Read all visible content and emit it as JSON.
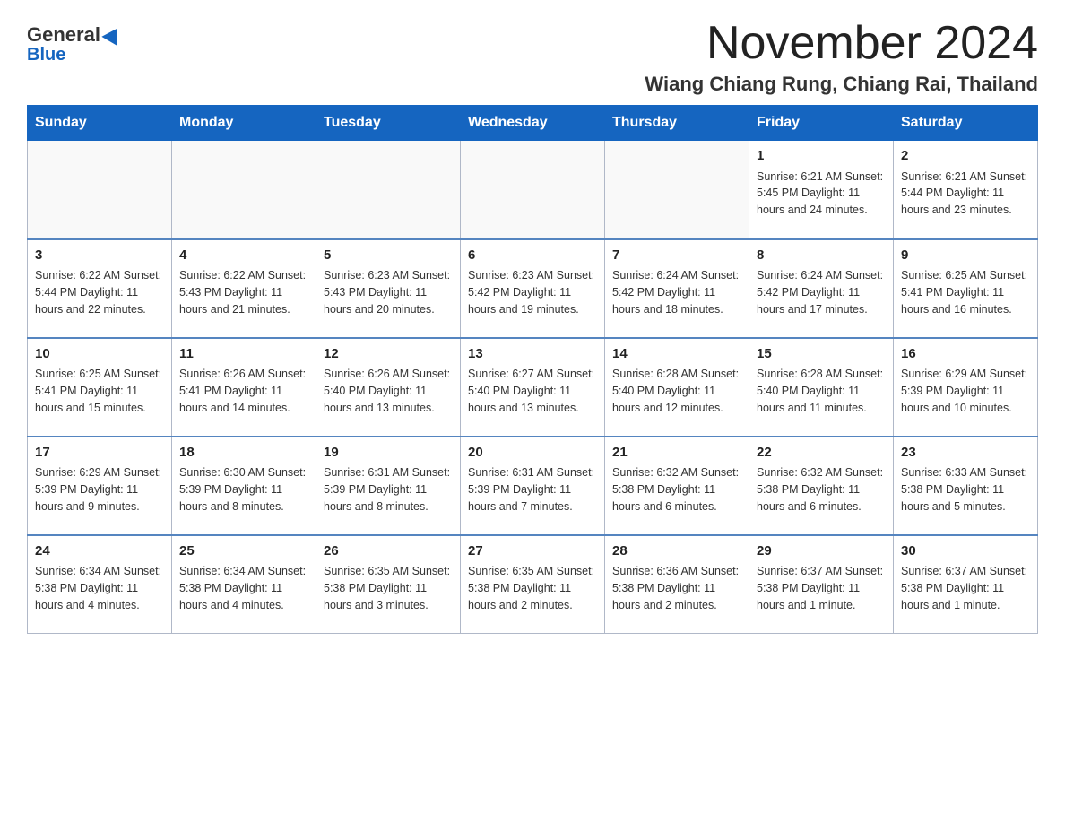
{
  "logo": {
    "general": "General",
    "blue": "Blue"
  },
  "header": {
    "month_title": "November 2024",
    "location": "Wiang Chiang Rung, Chiang Rai, Thailand"
  },
  "days_of_week": [
    "Sunday",
    "Monday",
    "Tuesday",
    "Wednesday",
    "Thursday",
    "Friday",
    "Saturday"
  ],
  "weeks": [
    [
      {
        "day": "",
        "info": ""
      },
      {
        "day": "",
        "info": ""
      },
      {
        "day": "",
        "info": ""
      },
      {
        "day": "",
        "info": ""
      },
      {
        "day": "",
        "info": ""
      },
      {
        "day": "1",
        "info": "Sunrise: 6:21 AM\nSunset: 5:45 PM\nDaylight: 11 hours and 24 minutes."
      },
      {
        "day": "2",
        "info": "Sunrise: 6:21 AM\nSunset: 5:44 PM\nDaylight: 11 hours and 23 minutes."
      }
    ],
    [
      {
        "day": "3",
        "info": "Sunrise: 6:22 AM\nSunset: 5:44 PM\nDaylight: 11 hours and 22 minutes."
      },
      {
        "day": "4",
        "info": "Sunrise: 6:22 AM\nSunset: 5:43 PM\nDaylight: 11 hours and 21 minutes."
      },
      {
        "day": "5",
        "info": "Sunrise: 6:23 AM\nSunset: 5:43 PM\nDaylight: 11 hours and 20 minutes."
      },
      {
        "day": "6",
        "info": "Sunrise: 6:23 AM\nSunset: 5:42 PM\nDaylight: 11 hours and 19 minutes."
      },
      {
        "day": "7",
        "info": "Sunrise: 6:24 AM\nSunset: 5:42 PM\nDaylight: 11 hours and 18 minutes."
      },
      {
        "day": "8",
        "info": "Sunrise: 6:24 AM\nSunset: 5:42 PM\nDaylight: 11 hours and 17 minutes."
      },
      {
        "day": "9",
        "info": "Sunrise: 6:25 AM\nSunset: 5:41 PM\nDaylight: 11 hours and 16 minutes."
      }
    ],
    [
      {
        "day": "10",
        "info": "Sunrise: 6:25 AM\nSunset: 5:41 PM\nDaylight: 11 hours and 15 minutes."
      },
      {
        "day": "11",
        "info": "Sunrise: 6:26 AM\nSunset: 5:41 PM\nDaylight: 11 hours and 14 minutes."
      },
      {
        "day": "12",
        "info": "Sunrise: 6:26 AM\nSunset: 5:40 PM\nDaylight: 11 hours and 13 minutes."
      },
      {
        "day": "13",
        "info": "Sunrise: 6:27 AM\nSunset: 5:40 PM\nDaylight: 11 hours and 13 minutes."
      },
      {
        "day": "14",
        "info": "Sunrise: 6:28 AM\nSunset: 5:40 PM\nDaylight: 11 hours and 12 minutes."
      },
      {
        "day": "15",
        "info": "Sunrise: 6:28 AM\nSunset: 5:40 PM\nDaylight: 11 hours and 11 minutes."
      },
      {
        "day": "16",
        "info": "Sunrise: 6:29 AM\nSunset: 5:39 PM\nDaylight: 11 hours and 10 minutes."
      }
    ],
    [
      {
        "day": "17",
        "info": "Sunrise: 6:29 AM\nSunset: 5:39 PM\nDaylight: 11 hours and 9 minutes."
      },
      {
        "day": "18",
        "info": "Sunrise: 6:30 AM\nSunset: 5:39 PM\nDaylight: 11 hours and 8 minutes."
      },
      {
        "day": "19",
        "info": "Sunrise: 6:31 AM\nSunset: 5:39 PM\nDaylight: 11 hours and 8 minutes."
      },
      {
        "day": "20",
        "info": "Sunrise: 6:31 AM\nSunset: 5:39 PM\nDaylight: 11 hours and 7 minutes."
      },
      {
        "day": "21",
        "info": "Sunrise: 6:32 AM\nSunset: 5:38 PM\nDaylight: 11 hours and 6 minutes."
      },
      {
        "day": "22",
        "info": "Sunrise: 6:32 AM\nSunset: 5:38 PM\nDaylight: 11 hours and 6 minutes."
      },
      {
        "day": "23",
        "info": "Sunrise: 6:33 AM\nSunset: 5:38 PM\nDaylight: 11 hours and 5 minutes."
      }
    ],
    [
      {
        "day": "24",
        "info": "Sunrise: 6:34 AM\nSunset: 5:38 PM\nDaylight: 11 hours and 4 minutes."
      },
      {
        "day": "25",
        "info": "Sunrise: 6:34 AM\nSunset: 5:38 PM\nDaylight: 11 hours and 4 minutes."
      },
      {
        "day": "26",
        "info": "Sunrise: 6:35 AM\nSunset: 5:38 PM\nDaylight: 11 hours and 3 minutes."
      },
      {
        "day": "27",
        "info": "Sunrise: 6:35 AM\nSunset: 5:38 PM\nDaylight: 11 hours and 2 minutes."
      },
      {
        "day": "28",
        "info": "Sunrise: 6:36 AM\nSunset: 5:38 PM\nDaylight: 11 hours and 2 minutes."
      },
      {
        "day": "29",
        "info": "Sunrise: 6:37 AM\nSunset: 5:38 PM\nDaylight: 11 hours and 1 minute."
      },
      {
        "day": "30",
        "info": "Sunrise: 6:37 AM\nSunset: 5:38 PM\nDaylight: 11 hours and 1 minute."
      }
    ]
  ]
}
